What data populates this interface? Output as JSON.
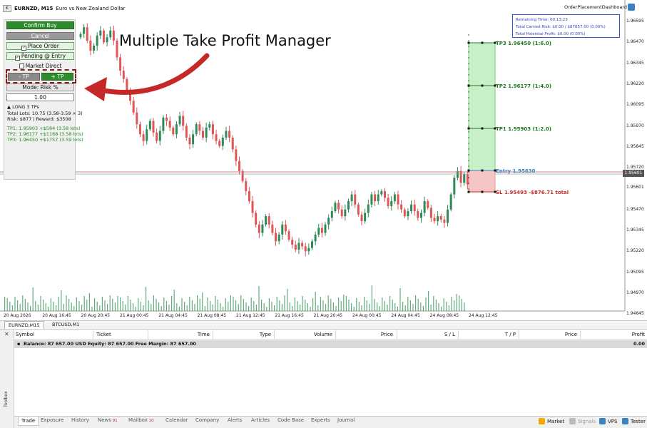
{
  "chart": {
    "title": "EURNZD, M15:  Euro vs New Zealand Dollar",
    "title_symbol": "EURNZD, M15",
    "title_desc": "Euro vs New Zealand Dollar",
    "order_dashboard_label": "OrderPlacementDashboard",
    "headline": "Multiple Take Profit Manager",
    "price_ticks": [
      "1.96595",
      "1.96470",
      "1.96345",
      "1.96220",
      "1.96095",
      "1.95970",
      "1.95845",
      "1.95720",
      "1.95601",
      "1.95470",
      "1.95345",
      "1.95220",
      "1.95095",
      "1.94970",
      "1.94845"
    ],
    "current_price": "1.95601",
    "time_ticks": [
      "20 Aug 2026",
      "20 Aug 16:45",
      "20 Aug 20:45",
      "21 Aug 00:45",
      "21 Aug 04:45",
      "21 Aug 08:45",
      "21 Aug 12:45",
      "21 Aug 16:45",
      "21 Aug 20:45",
      "24 Aug 00:45",
      "24 Aug 04:45",
      "24 Aug 08:45",
      "24 Aug 12:45"
    ]
  },
  "info_box": {
    "remaining_time": "Remaining Time: 00:13:23",
    "carried_risk": "Total Carried Risk: $0.00 / $87657.00 (0.00%)",
    "potential_profit": "Total Potential Profit: $0.00 (0.00%)"
  },
  "panel": {
    "confirm_buy": "Confirm Buy",
    "cancel": "Cancel",
    "place_order": "Place Order",
    "pending_entry": "Pending @ Entry",
    "market_direct": "Market Direct",
    "minus_tp": "- TP",
    "plus_tp": "+ TP",
    "mode": "Mode: Risk %",
    "risk_value": "1.00",
    "direction": "▲ LONG  3 TPs",
    "total_lots": "Total Lots: 10.75 (3.58-3.59 × 3)",
    "risk_reward": "Risk: $877 | Reward: $3508",
    "tp1": "TP1: 1.95903  +$584 (3.58 lots)",
    "tp2": "TP2: 1.96177  +$1168 (3.58 lots)",
    "tp3": "TP3: 1.96450  +$1757 (3.59 lots)"
  },
  "levels": {
    "tp3": "TP3 1.96450 (1:6.0)",
    "tp2": "TP2 1.96177 (1:4.0)",
    "tp1": "TP1 1.95903 (1:2.0)",
    "entry": "Entry 1.95630",
    "sl": "SL 1.95493  -$876.71 total"
  },
  "chart_tabs": [
    "EURNZD,M15",
    "BTCUSD,M1"
  ],
  "terminal": {
    "columns": [
      "Symbol",
      "Ticket",
      "Time",
      "Type",
      "Volume",
      "Price",
      "S / L",
      "T / P",
      "Price",
      "Profit"
    ],
    "balance_row": "Balance: 87 657.00 USD  Equity: 87 657.00  Free Margin: 87 657.00",
    "balance_profit": "0.00",
    "toolbox_label": "Toolbox",
    "tabs": [
      {
        "label": "Trade",
        "count": ""
      },
      {
        "label": "Exposure",
        "count": ""
      },
      {
        "label": "History",
        "count": ""
      },
      {
        "label": "News",
        "count": "91"
      },
      {
        "label": "Mailbox",
        "count": "10"
      },
      {
        "label": "Calendar",
        "count": ""
      },
      {
        "label": "Company",
        "count": ""
      },
      {
        "label": "Alerts",
        "count": ""
      },
      {
        "label": "Articles",
        "count": ""
      },
      {
        "label": "Code Base",
        "count": ""
      },
      {
        "label": "Experts",
        "count": ""
      },
      {
        "label": "Journal",
        "count": ""
      }
    ],
    "right_tools": [
      {
        "label": "Market",
        "icon": "market-icon"
      },
      {
        "label": "Signals",
        "icon": "signals-icon"
      },
      {
        "label": "VPS",
        "icon": "vps-icon"
      },
      {
        "label": "Tester",
        "icon": "tester-icon"
      }
    ]
  },
  "colors": {
    "bull": "#2e8b57",
    "bear": "#e05555",
    "tp_zone": "#c8f0c8",
    "sl_zone": "#f6c6c6",
    "arrow": "#c62828",
    "accent_green": "#2e8b2e"
  }
}
